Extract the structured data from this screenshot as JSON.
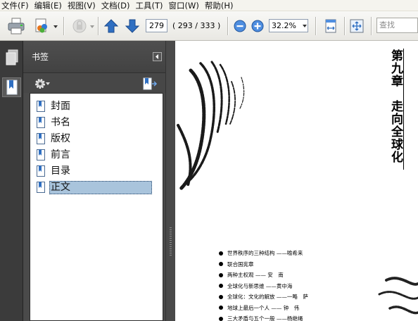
{
  "menu": [
    "文件(F)",
    "编辑(E)",
    "视图(V)",
    "文档(D)",
    "工具(T)",
    "窗口(W)",
    "帮助(H)"
  ],
  "toolbar": {
    "page_number": "279",
    "page_count": "( 293 / 333 )",
    "zoom": "32.2%",
    "search_placeholder": "查找"
  },
  "panel": {
    "title": "书签",
    "bookmarks": [
      {
        "label": "封面",
        "selected": false
      },
      {
        "label": "书名",
        "selected": false
      },
      {
        "label": "版权",
        "selected": false
      },
      {
        "label": "前言",
        "selected": false
      },
      {
        "label": "目录",
        "selected": false
      },
      {
        "label": "正文",
        "selected": true
      }
    ]
  },
  "document": {
    "chapter": "第九章　走向全球化",
    "bullets": [
      "世界秩序的三种结构 ——喻希来",
      "联合国宪章",
      "两种主权观 —— 安　南",
      "全球化与新思维 ——黄中海",
      "全球化：文化的解放 ——一略　萨",
      "地球上最后一个人 —— 钟　伟",
      "三大矛盾与五个一般 ——杨继绳"
    ]
  },
  "colors": {
    "panel_bg": "#4a4a4a",
    "selection": "#a9c4dc",
    "accent_blue": "#2f6fc2"
  },
  "icons": [
    "print-icon",
    "collaborate-icon",
    "secure-icon",
    "previous-page-icon",
    "next-page-icon",
    "zoom-out-icon",
    "zoom-in-icon",
    "fit-width-icon",
    "page-layout-icon",
    "fullscreen-icon",
    "pages-icon",
    "bookmarks-icon",
    "gear-icon",
    "expand-bookmark-icon",
    "bookmark-icon"
  ]
}
